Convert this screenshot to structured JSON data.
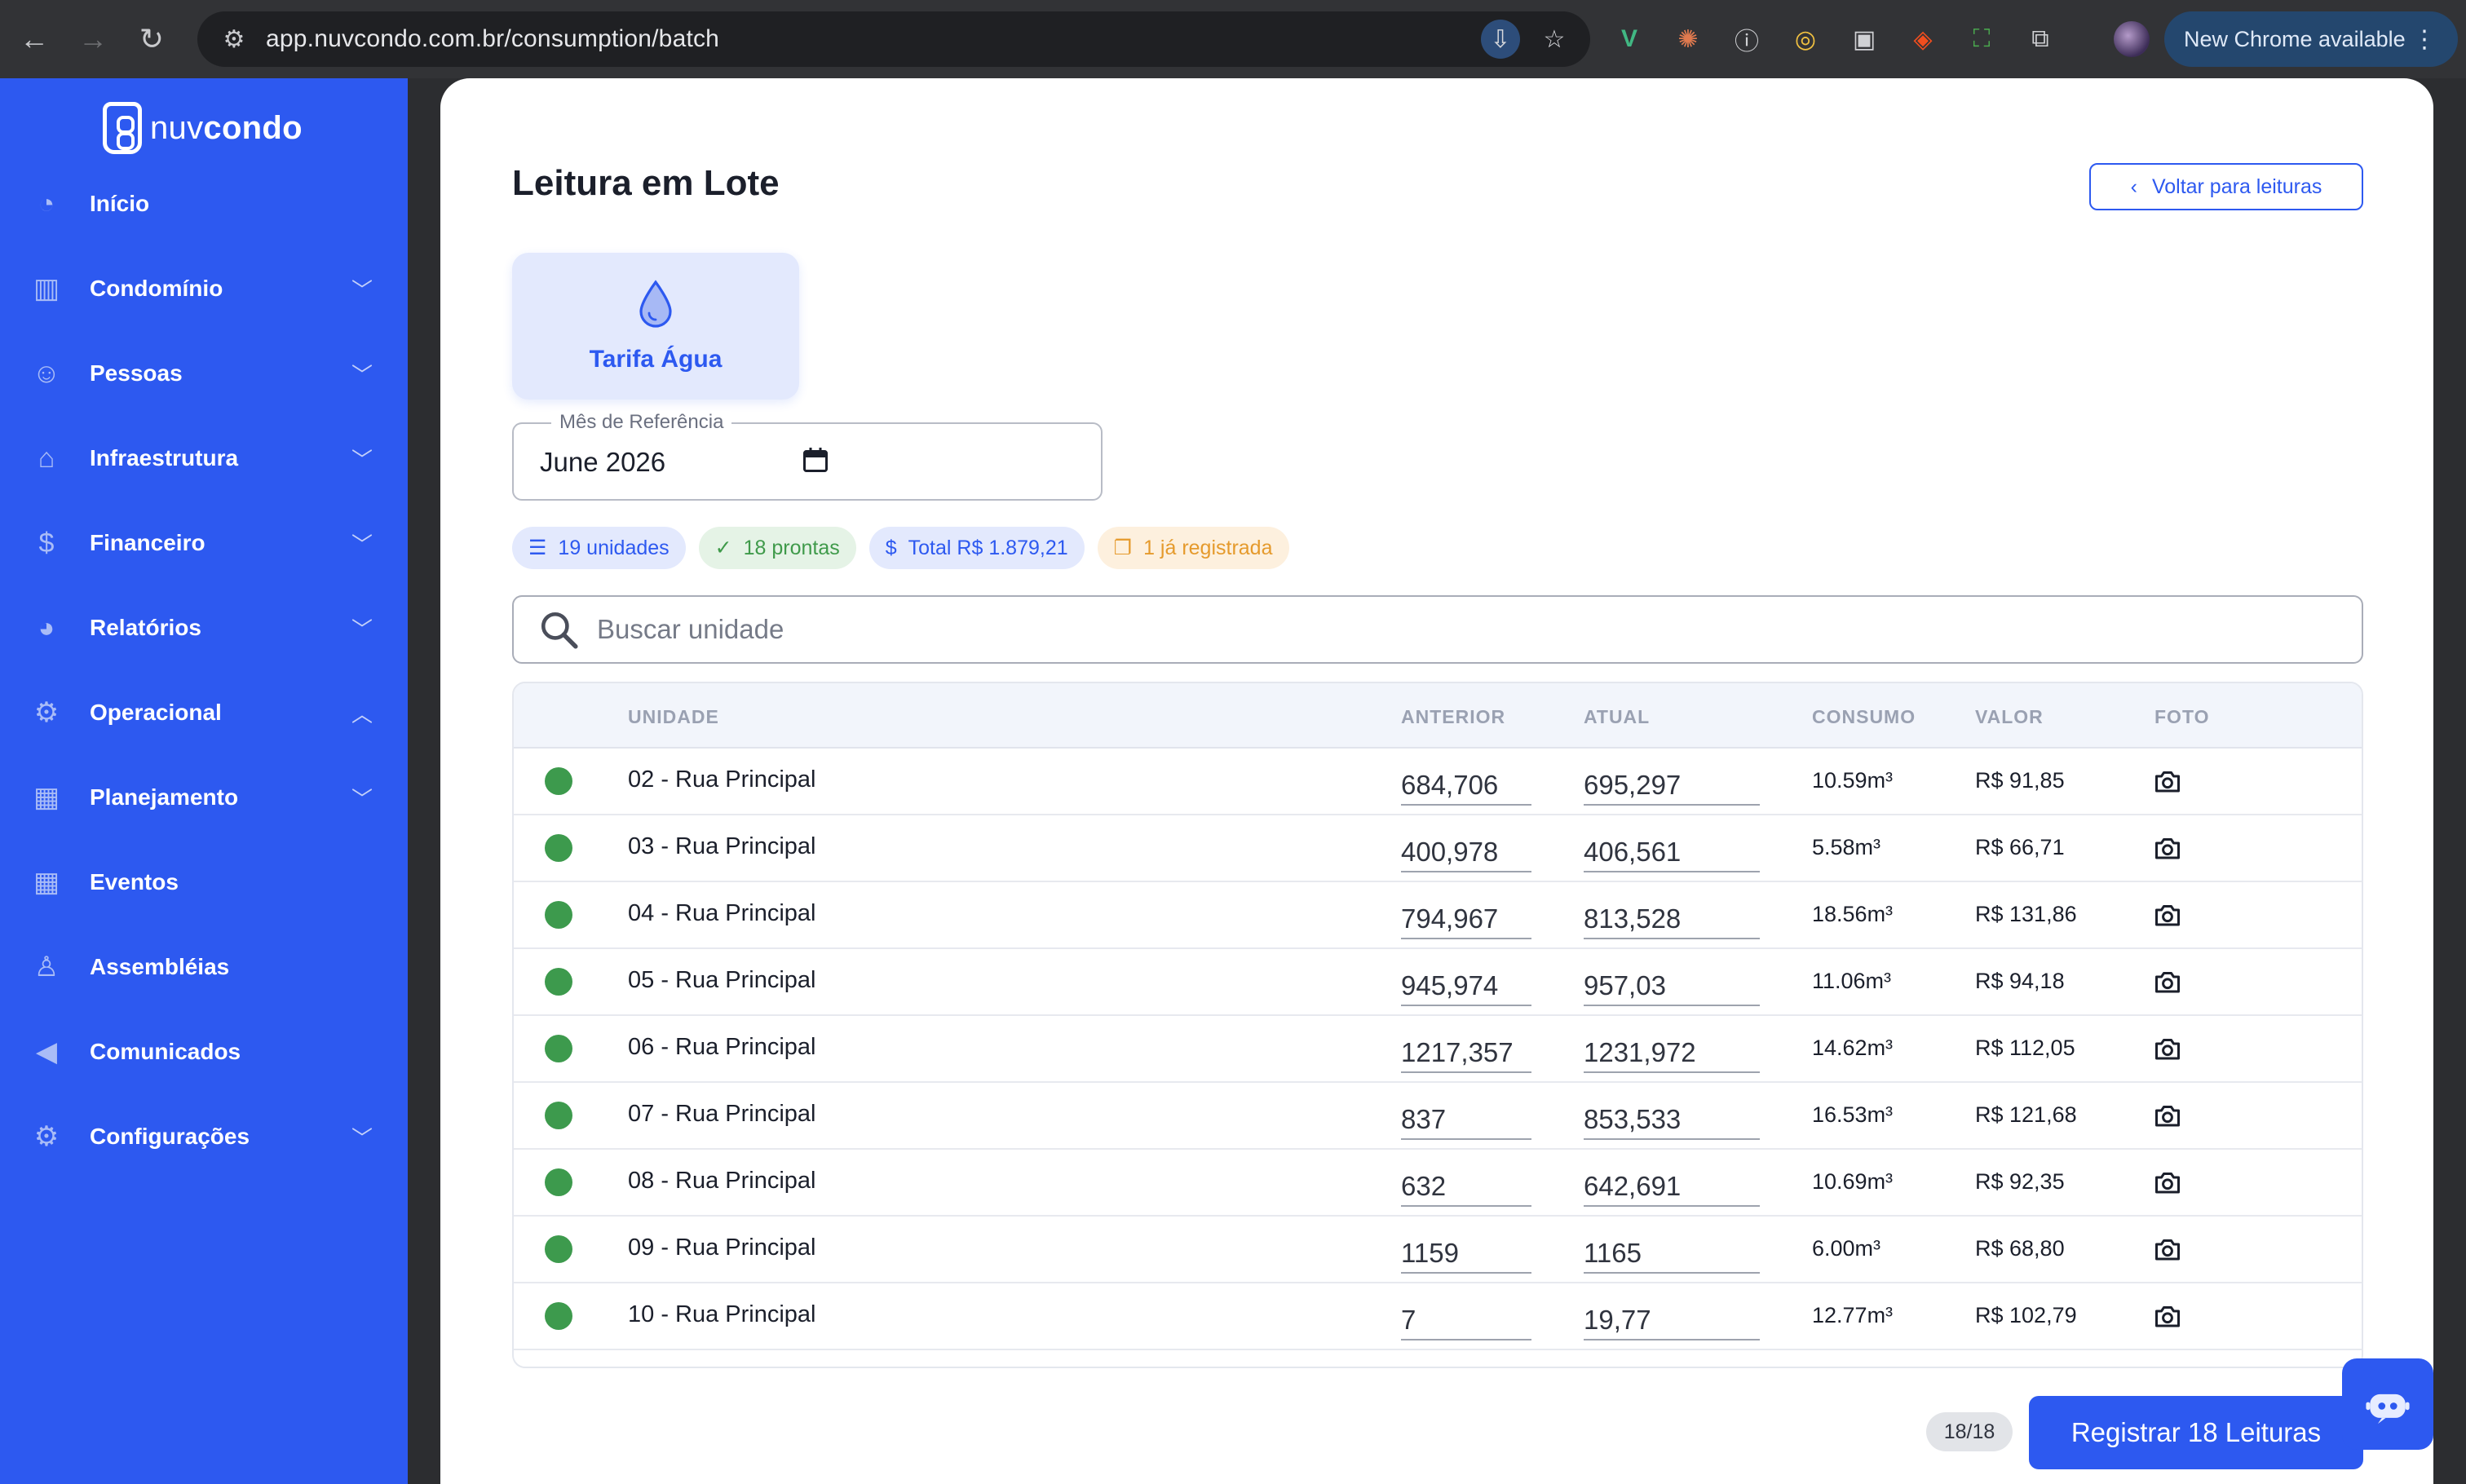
{
  "browser": {
    "url": "app.nuvcondo.com.br/consumption/batch",
    "update_label": "New Chrome available"
  },
  "sidebar": {
    "brand": {
      "prefix": "nuv",
      "suffix": "condo"
    },
    "items": [
      {
        "label": "Início",
        "icon": "gauge-icon",
        "expandable": false
      },
      {
        "label": "Condomínio",
        "icon": "building-icon",
        "expandable": true,
        "expanded": false
      },
      {
        "label": "Pessoas",
        "icon": "people-icon",
        "expandable": true,
        "expanded": false
      },
      {
        "label": "Infraestrutura",
        "icon": "bank-icon",
        "expandable": true,
        "expanded": false
      },
      {
        "label": "Financeiro",
        "icon": "dollar-icon",
        "expandable": true,
        "expanded": false
      },
      {
        "label": "Relatórios",
        "icon": "pie-chart-icon",
        "expandable": true,
        "expanded": false
      },
      {
        "label": "Operacional",
        "icon": "gears-icon",
        "expandable": true,
        "expanded": true
      },
      {
        "label": "Planejamento",
        "icon": "calendar-icon",
        "expandable": true,
        "expanded": false
      },
      {
        "label": "Eventos",
        "icon": "calendar-icon",
        "expandable": false
      },
      {
        "label": "Assembléias",
        "icon": "group-icon",
        "expandable": false
      },
      {
        "label": "Comunicados",
        "icon": "megaphone-icon",
        "expandable": false
      },
      {
        "label": "Configurações",
        "icon": "gear-icon",
        "expandable": true,
        "expanded": false
      }
    ]
  },
  "main": {
    "title": "Leitura em Lote",
    "back_label": "Voltar para leituras",
    "tariff_label": "Tarifa Água",
    "month_field": {
      "label": "Mês de Referência",
      "value": "June  2026"
    },
    "chips": {
      "units": "19 unidades",
      "ready": "18 prontas",
      "total": "Total R$ 1.879,21",
      "registered": "1 já registrada"
    },
    "search_placeholder": "Buscar unidade",
    "table": {
      "headers": {
        "unit": "UNIDADE",
        "previous": "ANTERIOR",
        "current": "ATUAL",
        "consumption": "CONSUMO",
        "value": "VALOR",
        "photo": "FOTO"
      },
      "rows": [
        {
          "unit": "02 - Rua Principal",
          "previous": "684,706",
          "current": "695,297",
          "consumption": "10.59m³",
          "value": "R$ 91,85"
        },
        {
          "unit": "03 - Rua Principal",
          "previous": "400,978",
          "current": "406,561",
          "consumption": "5.58m³",
          "value": "R$ 66,71"
        },
        {
          "unit": "04 - Rua Principal",
          "previous": "794,967",
          "current": "813,528",
          "consumption": "18.56m³",
          "value": "R$ 131,86"
        },
        {
          "unit": "05 - Rua Principal",
          "previous": "945,974",
          "current": "957,03",
          "consumption": "11.06m³",
          "value": "R$ 94,18"
        },
        {
          "unit": "06 - Rua Principal",
          "previous": "1217,357",
          "current": "1231,972",
          "consumption": "14.62m³",
          "value": "R$ 112,05"
        },
        {
          "unit": "07 - Rua Principal",
          "previous": "837",
          "current": "853,533",
          "consumption": "16.53m³",
          "value": "R$ 121,68"
        },
        {
          "unit": "08 - Rua Principal",
          "previous": "632",
          "current": "642,691",
          "consumption": "10.69m³",
          "value": "R$ 92,35"
        },
        {
          "unit": "09 - Rua Principal",
          "previous": "1159",
          "current": "1165",
          "consumption": "6.00m³",
          "value": "R$ 68,80"
        },
        {
          "unit": "10 - Rua Principal",
          "previous": "7",
          "current": "19,77",
          "consumption": "12.77m³",
          "value": "R$ 102,79"
        }
      ]
    },
    "counter": "18/18",
    "submit_label": "Registrar 18 Leituras"
  },
  "colors": {
    "brand": "#2d59f0",
    "ready_green": "#3d9a4d",
    "warning_orange": "#e59a2c"
  }
}
